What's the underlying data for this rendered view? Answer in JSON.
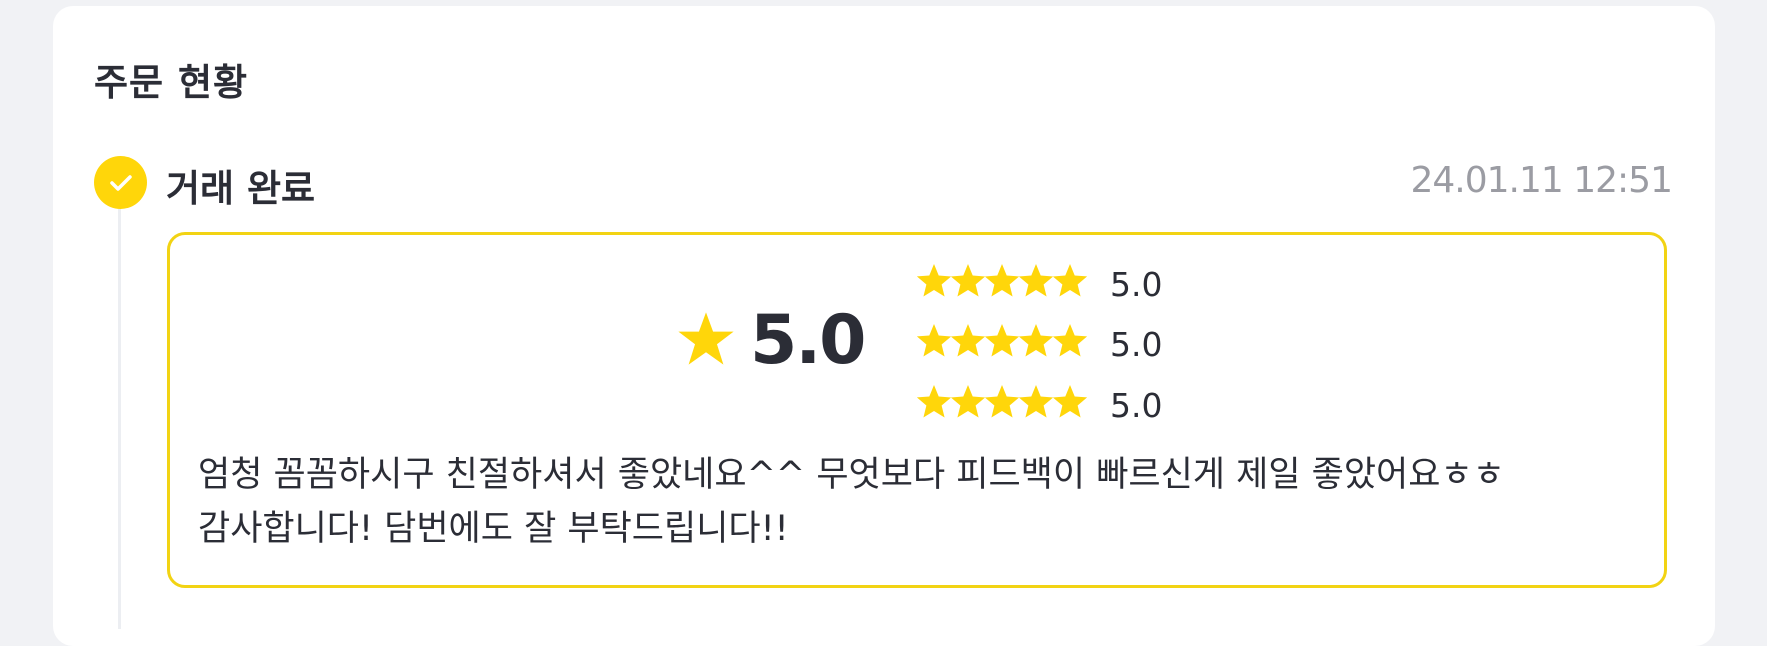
{
  "order_status": {
    "title": "주문 현황",
    "status_label": "거래 완료",
    "timestamp": "24.01.11 12:51",
    "status_icon": "check-icon",
    "accent_color": "#ffd60a"
  },
  "review": {
    "overall_score": "5.0",
    "overall_icon": "star-icon",
    "criteria": [
      {
        "stars": 5,
        "max_stars": 5,
        "score": "5.0"
      },
      {
        "stars": 5,
        "max_stars": 5,
        "score": "5.0"
      },
      {
        "stars": 5,
        "max_stars": 5,
        "score": "5.0"
      }
    ],
    "text_line1": "엄청 꼼꼼하시구 친절하셔서 좋았네요^^ 무엇보다 피드백이 빠르신게 제일 좋았어요ㅎㅎ",
    "text_line2": "감사합니다! 담번에도 잘 부탁드립니다!!",
    "border_color": "#f2d313",
    "star_color": "#ffd60a"
  }
}
